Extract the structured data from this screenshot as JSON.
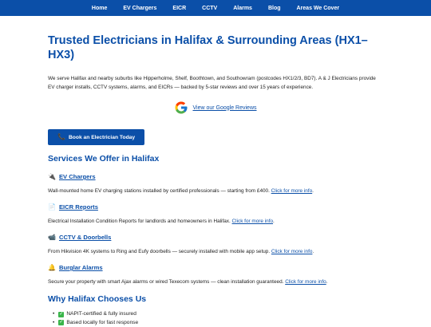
{
  "nav": [
    "Home",
    "EV Chargers",
    "EICR",
    "CCTV",
    "Alarms",
    "Blog",
    "Areas We Cover"
  ],
  "title": "Trusted Electricians in Halifax & Surrounding Areas (HX1–HX3)",
  "intro": "We serve Halifax and nearby suburbs like Hipperholme, Shelf, Boothtown, and Southowram (postcodes HX1/2/3, BD7). A & J Electricians provide EV charger installs, CCTV systems, alarms, and EICRs — backed by 5-star reviews and over 15 years of experience.",
  "review_link": "View our Google Reviews",
  "book_button": "Book an Electrician Today",
  "book_icon": "phone-icon",
  "services_heading": "Services We Offer in Halifax",
  "services": [
    {
      "icon": "plug-icon",
      "emoji": "🔌",
      "title": "EV Chargers",
      "desc": "Wall-mounted home EV charging stations installed by certified professionals — starting from £400.",
      "link": "Click for more info"
    },
    {
      "icon": "document-icon",
      "emoji": "📄",
      "title": "EICR Reports",
      "desc": "Electrical Installation Condition Reports for landlords and homeowners in Halifax.",
      "link": "Click for more info"
    },
    {
      "icon": "camera-icon",
      "emoji": "📹",
      "title": "CCTV & Doorbells",
      "desc": "From Hikvision 4K systems to Ring and Eufy doorbells — securely installed with mobile app setup.",
      "link": "Click for more info"
    },
    {
      "icon": "bell-icon",
      "emoji": "🔔",
      "title": "Burglar Alarms",
      "desc": "Secure your property with smart Ajax alarms or wired Texecom systems — clean installation guaranteed.",
      "link": "Click for more info"
    }
  ],
  "why_heading": "Why Halifax Chooses Us",
  "why_items": [
    "NAPIT-certified & fully insured",
    "Based locally for fast response"
  ],
  "colors": {
    "primary": "#0b4fa8",
    "check": "#3ab54a"
  }
}
